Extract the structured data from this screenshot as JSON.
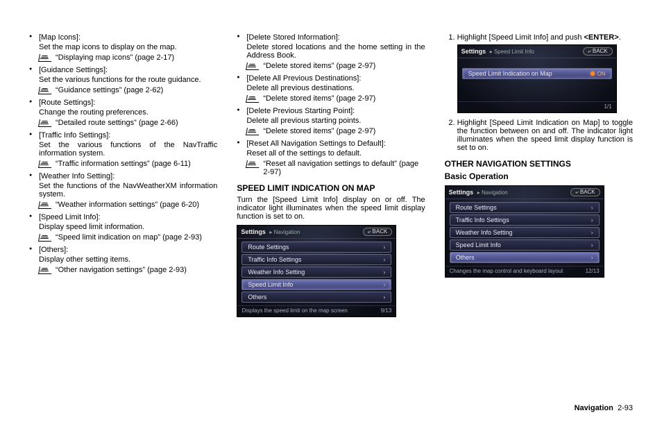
{
  "col1": {
    "items": [
      {
        "title": "[Map Icons]:",
        "desc": "Set the map icons to display on the map.",
        "ref": "“Displaying map icons” (page 2-17)"
      },
      {
        "title": "[Guidance Settings]:",
        "desc": "Set the various functions for the route guidance.",
        "ref": "“Guidance settings” (page 2-62)"
      },
      {
        "title": "[Route Settings]:",
        "desc": "Change the routing preferences.",
        "ref": "“Detailed route settings” (page 2-66)"
      },
      {
        "title": "[Traffic Info Settings]:",
        "desc": "Set the various functions of the NavTraffic information system.",
        "ref": "“Traffic information settings” (page 6-11)"
      },
      {
        "title": "[Weather Info Setting]:",
        "desc": "Set the functions of the NavWeatherXM information system.",
        "ref": "“Weather information settings” (page 6-20)"
      },
      {
        "title": "[Speed Limit Info]:",
        "desc": "Display speed limit information.",
        "ref": "“Speed limit indication on map” (page 2-93)"
      },
      {
        "title": "[Others]:",
        "desc": "Display other setting items.",
        "ref": "“Other navigation settings” (page 2-93)"
      }
    ]
  },
  "col2": {
    "items": [
      {
        "title": "[Delete Stored Information]:",
        "desc": "Delete stored locations and the home setting in the Address Book.",
        "ref": "“Delete stored items” (page 2-97)"
      },
      {
        "title": "[Delete All Previous Destinations]:",
        "desc": "Delete all previous destinations.",
        "ref": "“Delete stored items” (page 2-97)"
      },
      {
        "title": "[Delete Previous Starting Point]:",
        "desc": "Delete all previous starting points.",
        "ref": "“Delete stored items” (page 2-97)"
      },
      {
        "title": "[Reset All Navigation Settings to Default]:",
        "desc": "Reset all of the settings to default.",
        "ref": "“Reset all navigation settings to default” (page 2-97)"
      }
    ],
    "heading": "SPEED LIMIT INDICATION ON MAP",
    "para": "Turn the [Speed Limit Info] display on or off. The indicator light illuminates when the speed limit display function is set to on."
  },
  "nav1": {
    "title": "Settings",
    "crumb": "Navigation",
    "back": "BACK",
    "rows": [
      "Route Settings",
      "Traffic Info Settings",
      "Weather Info Setting",
      "Speed Limit Info",
      "Others"
    ],
    "sel_index": 3,
    "counter": "9/13",
    "footer": "Displays the speed limit on the map screen"
  },
  "col3": {
    "step1a": "Highlight [Speed Limit Info] and push ",
    "step1b": "<ENTER>",
    "step1c": ".",
    "step2": "Highlight [Speed Limit Indication on Map] to toggle the function between on and off. The indicator light illuminates when the speed limit display function is set to on.",
    "heading1": "OTHER NAVIGATION SETTINGS",
    "heading2": "Basic Operation"
  },
  "nav2": {
    "title": "Settings",
    "crumb": "Speed Limit Info",
    "back": "BACK",
    "row": "Speed Limit Indication on Map",
    "on": "ON",
    "counter": "1/1"
  },
  "nav3": {
    "title": "Settings",
    "crumb": "Navigation",
    "back": "BACK",
    "rows": [
      "Route Settings",
      "Traffic Info Settings",
      "Weather Info Setting",
      "Speed Limit Info",
      "Others"
    ],
    "sel_index": 4,
    "counter": "12/13",
    "footer": "Changes the map control and keyboard layout"
  },
  "page": {
    "section": "Navigation",
    "num": "2-93"
  }
}
